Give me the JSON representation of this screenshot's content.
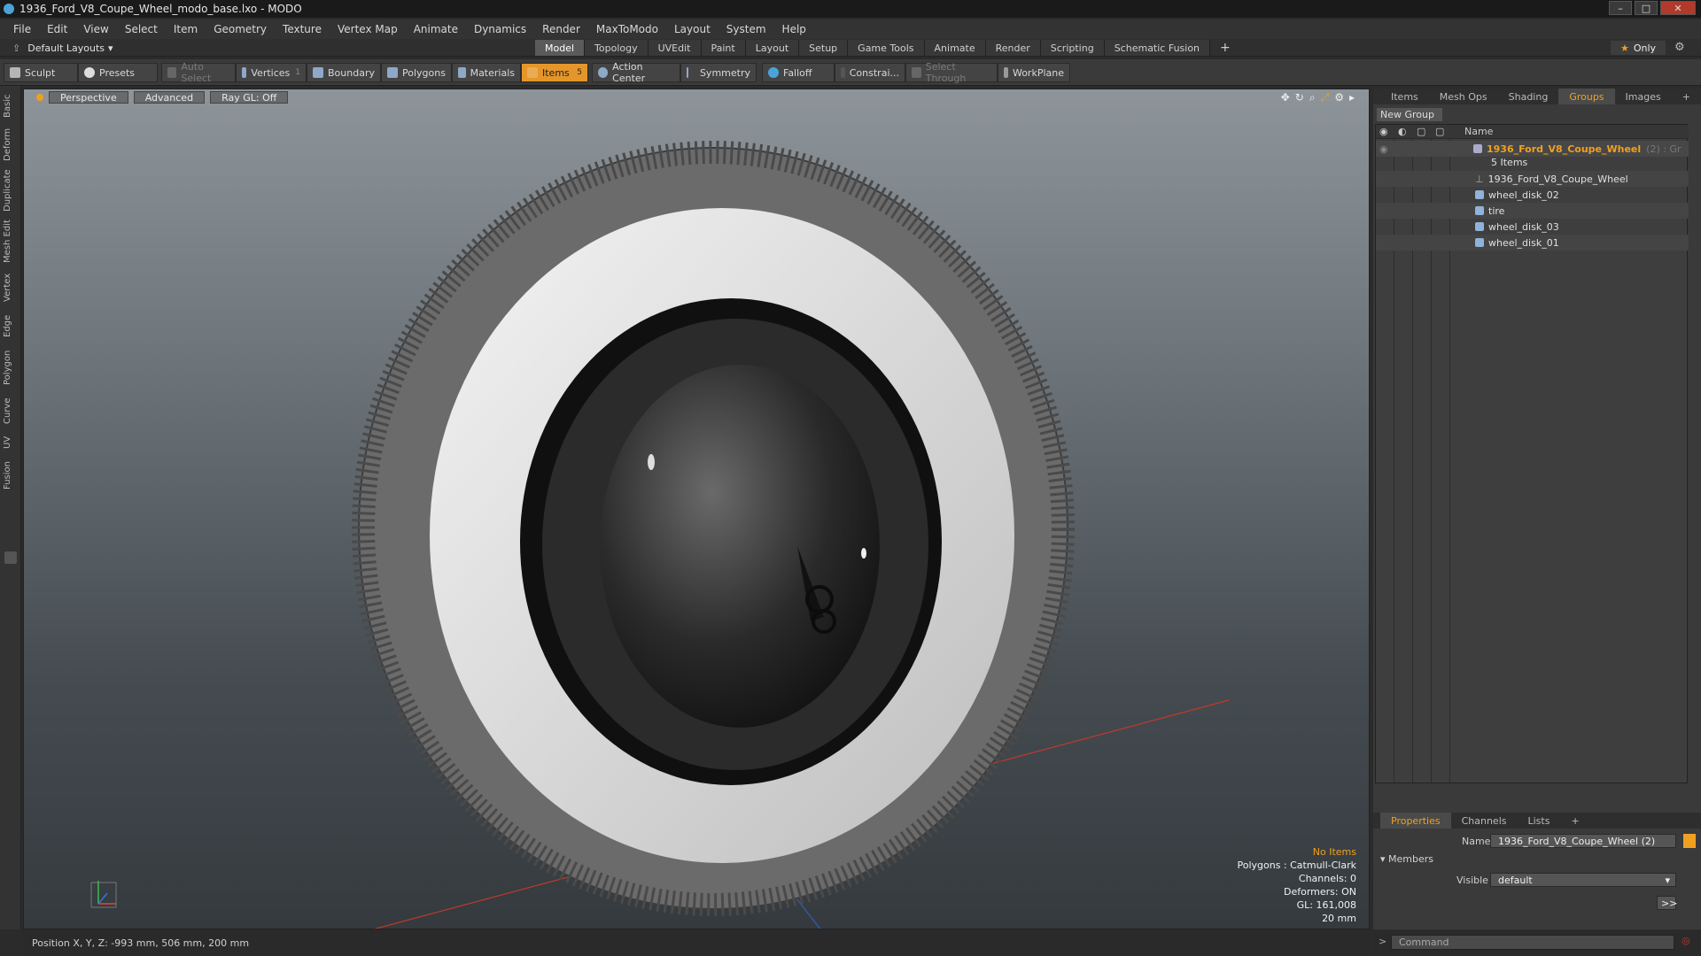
{
  "window": {
    "title": "1936_Ford_V8_Coupe_Wheel_modo_base.lxo - MODO"
  },
  "menu": [
    "File",
    "Edit",
    "View",
    "Select",
    "Item",
    "Geometry",
    "Texture",
    "Vertex Map",
    "Animate",
    "Dynamics",
    "Render",
    "MaxToModo",
    "Layout",
    "System",
    "Help"
  ],
  "layout": {
    "dropdown": "Default Layouts",
    "tabs": [
      "Model",
      "Topology",
      "UVEdit",
      "Paint",
      "Layout",
      "Setup",
      "Game Tools",
      "Animate",
      "Render",
      "Scripting",
      "Schematic Fusion"
    ],
    "active_tab": "Model",
    "only_label": "Only"
  },
  "toolbar": {
    "sculpt": "Sculpt",
    "presets": "Presets",
    "auto_select": "Auto Select",
    "vertices": "Vertices",
    "vertices_count": "1",
    "boundary": "Boundary",
    "polygons": "Polygons",
    "materials": "Materials",
    "items": "Items",
    "items_count": "5",
    "action_center": "Action Center",
    "symmetry": "Symmetry",
    "falloff": "Falloff",
    "constraints": "Constrai...",
    "select_through": "Select Through",
    "workplane": "WorkPlane"
  },
  "left_tabs": [
    "Basic",
    "Deform",
    "Duplicate",
    "Mesh Edit",
    "Vertex",
    "Edge",
    "Polygon",
    "Curve",
    "UV",
    "Fusion"
  ],
  "viewport": {
    "view_mode": "Perspective",
    "shading": "Advanced",
    "raygl": "Ray GL: Off",
    "stats": {
      "items": "No Items",
      "polygons": "Polygons : Catmull-Clark",
      "channels": "Channels: 0",
      "deformers": "Deformers: ON",
      "gl": "GL: 161,008",
      "unit": "20 mm"
    }
  },
  "status": {
    "position": "Position X, Y, Z:  -993 mm, 506 mm, 200 mm"
  },
  "right_panel": {
    "tabs": [
      "Items",
      "Mesh Ops",
      "Shading",
      "Groups",
      "Images",
      "+"
    ],
    "active_tab": "Groups",
    "new_group": "New Group",
    "column_name": "Name",
    "group": {
      "name": "1936_Ford_V8_Coupe_Wheel",
      "suffix": "(2) : Gr",
      "count": "5 Items"
    },
    "children": [
      "1936_Ford_V8_Coupe_Wheel",
      "wheel_disk_02",
      "tire",
      "wheel_disk_03",
      "wheel_disk_01"
    ]
  },
  "properties": {
    "tabs": [
      "Properties",
      "Channels",
      "Lists",
      "+"
    ],
    "active_tab": "Properties",
    "name_label": "Name",
    "name_value": "1936_Ford_V8_Coupe_Wheel (2)",
    "members": "Members",
    "visible_label": "Visible",
    "visible_value": "default",
    "expand": ">>"
  },
  "command": {
    "placeholder": "Command"
  },
  "colors": {
    "accent": "#f0a020",
    "viewport_top": "#8d949a",
    "viewport_bottom": "#353a3e"
  }
}
